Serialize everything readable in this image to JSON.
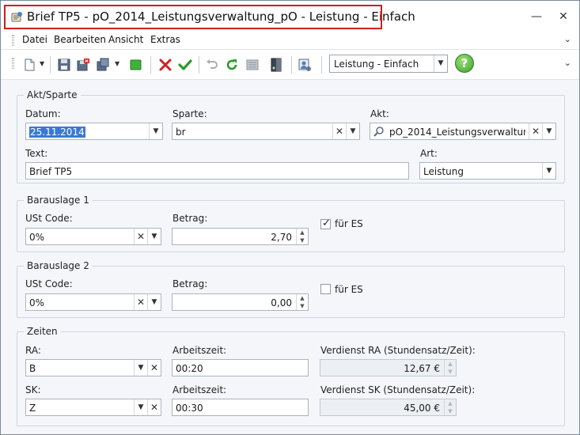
{
  "window": {
    "title": "Brief TP5 - pO_2014_Leistungsverwaltung_pO - Leistung - Einfach",
    "minimize": "—",
    "close": "✕"
  },
  "menu": {
    "items": [
      "Datei",
      "Bearbeiten",
      "Ansicht",
      "Extras"
    ],
    "overflow": "⌄"
  },
  "toolbar": {
    "layout_combo": "Leistung - Einfach",
    "help_label": "?",
    "overflow": "⌄"
  },
  "akt_sparte": {
    "title": "Akt/Sparte",
    "datum_label": "Datum:",
    "datum_value": "25.11.2014",
    "sparte_label": "Sparte:",
    "sparte_value": "br",
    "akt_label": "Akt:",
    "akt_value": "pO_2014_Leistungsverwaltung...",
    "text_label": "Text:",
    "text_value": "Brief TP5",
    "art_label": "Art:",
    "art_value": "Leistung"
  },
  "barauslage1": {
    "title": "Barauslage 1",
    "ust_label": "USt Code:",
    "ust_value": "0%",
    "betrag_label": "Betrag:",
    "betrag_value": "2,70",
    "fuer_es_label": "für ES",
    "fuer_es_checked": true
  },
  "barauslage2": {
    "title": "Barauslage 2",
    "ust_label": "USt Code:",
    "ust_value": "0%",
    "betrag_label": "Betrag:",
    "betrag_value": "0,00",
    "fuer_es_label": "für ES",
    "fuer_es_checked": false
  },
  "zeiten": {
    "title": "Zeiten",
    "ra_label": "RA:",
    "ra_value": "B",
    "ra_arbeitszeit_label": "Arbeitszeit:",
    "ra_arbeitszeit_value": "00:20",
    "ra_verdienst_label": "Verdienst RA (Stundensatz/Zeit):",
    "ra_verdienst_value": "12,67 €",
    "sk_label": "SK:",
    "sk_value": "Z",
    "sk_arbeitszeit_label": "Arbeitszeit:",
    "sk_arbeitszeit_value": "00:30",
    "sk_verdienst_label": "Verdienst SK (Stundensatz/Zeit):",
    "sk_verdienst_value": "45,00 €"
  },
  "colors": {
    "title_highlight": "#cc1f1f",
    "selection": "#3a78d4",
    "delete_red": "#d42020",
    "confirm_green": "#2e9a2a",
    "help_green": "#3ea12a"
  }
}
